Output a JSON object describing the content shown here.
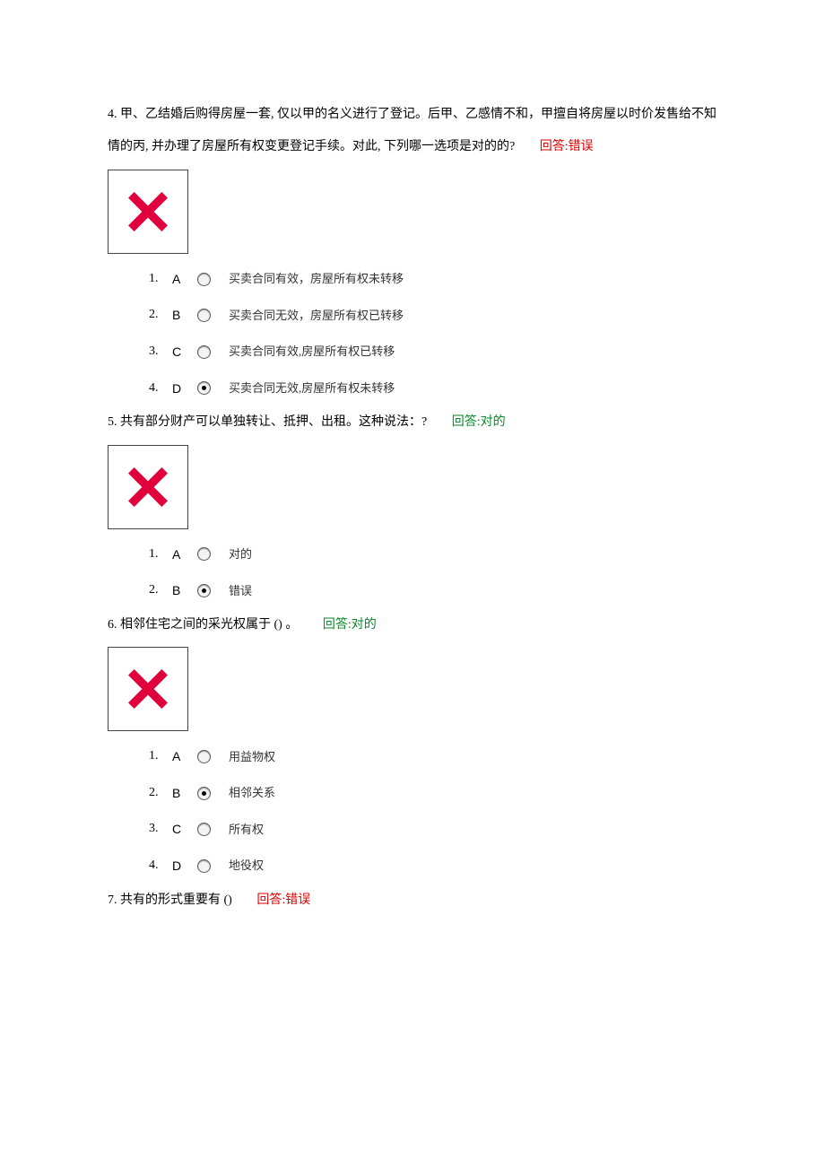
{
  "questions": [
    {
      "num": "4.",
      "text_a": "甲、乙结婚后购得房屋一套, 仅以甲的名义进行了登记。后甲、乙感情不和，甲擅自将房屋以时价发售给不知情的丙, 并办理了房屋所有权变更登记手续。对此, 下列哪一选项是对的的?",
      "answer_prefix": "回答:",
      "answer_value": "错误",
      "answer_class": "wrong",
      "mark": "x",
      "options": [
        {
          "n": "1.",
          "letter": "A",
          "text": "买卖合同有效，房屋所有权未转移",
          "selected": false
        },
        {
          "n": "2.",
          "letter": "B",
          "text": "买卖合同无效，房屋所有权已转移",
          "selected": false
        },
        {
          "n": "3.",
          "letter": "C",
          "text": "买卖合同有效,房屋所有权已转移",
          "selected": false
        },
        {
          "n": "4.",
          "letter": "D",
          "text": "买卖合同无效,房屋所有权未转移",
          "selected": true
        }
      ]
    },
    {
      "num": "5.",
      "text_a": "共有部分财产可以单独转让、抵押、出租。这种说法：?",
      "answer_prefix": "回答:",
      "answer_value": "对的",
      "answer_class": "correct",
      "mark": "x",
      "options": [
        {
          "n": "1.",
          "letter": "A",
          "text": "对的",
          "selected": false
        },
        {
          "n": "2.",
          "letter": "B",
          "text": "错误",
          "selected": true
        }
      ]
    },
    {
      "num": "6.",
      "text_a": "相邻住宅之间的采光权属于 () 。",
      "answer_prefix": "回答:",
      "answer_value": "对的",
      "answer_class": "correct",
      "mark": "x",
      "options": [
        {
          "n": "1.",
          "letter": "A",
          "text": "用益物权",
          "selected": false
        },
        {
          "n": "2.",
          "letter": "B",
          "text": "相邻关系",
          "selected": true
        },
        {
          "n": "3.",
          "letter": "C",
          "text": "所有权",
          "selected": false
        },
        {
          "n": "4.",
          "letter": "D",
          "text": "地役权",
          "selected": false
        }
      ]
    },
    {
      "num": "7.",
      "text_a": "共有的形式重要有 ()",
      "answer_prefix": "回答:",
      "answer_value": "错误",
      "answer_class": "wrong",
      "mark": null,
      "options": []
    }
  ]
}
